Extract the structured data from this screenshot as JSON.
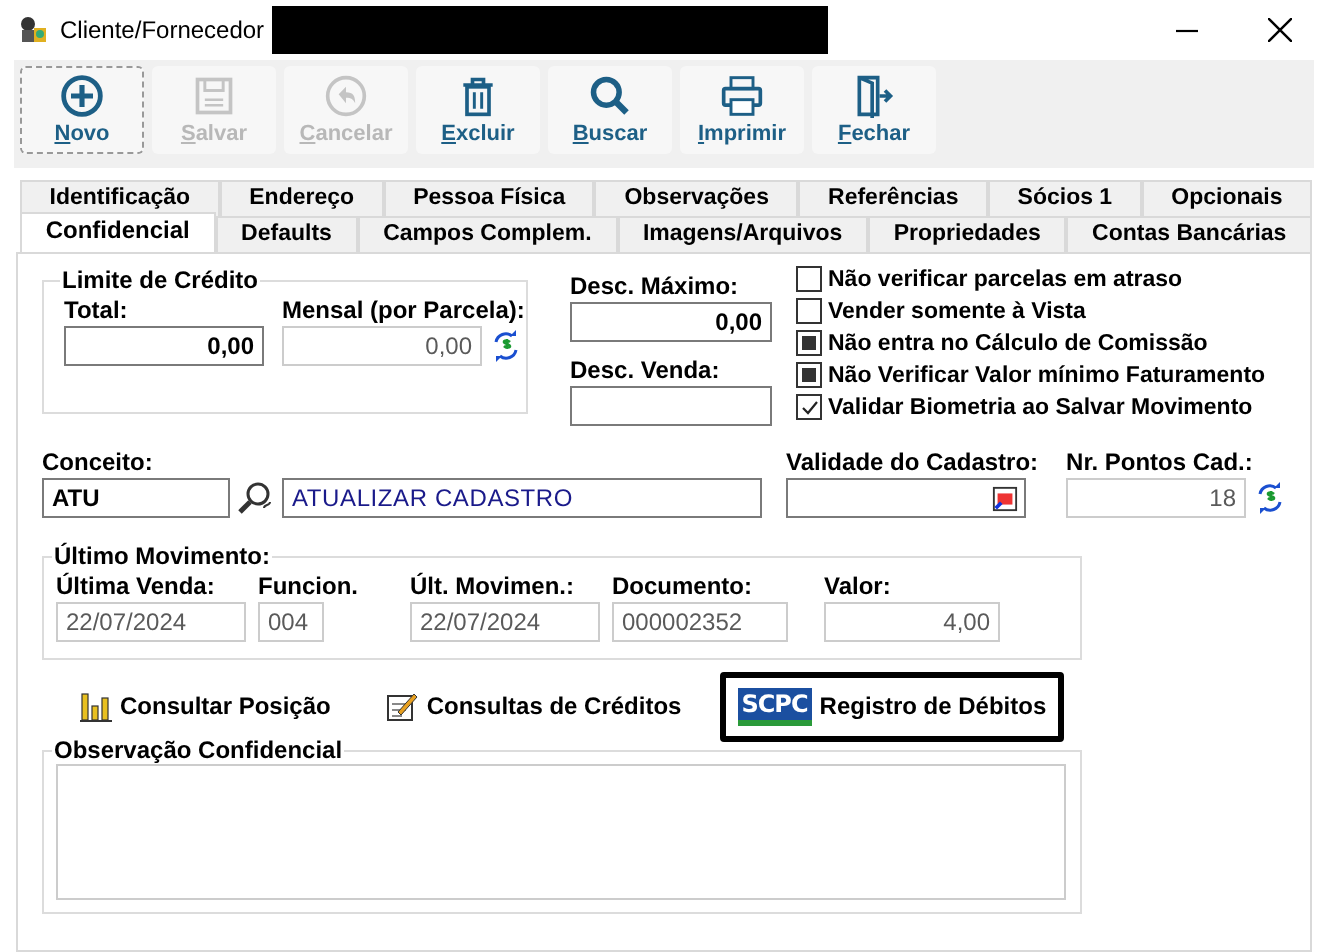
{
  "window": {
    "title": "Cliente/Fornecedor"
  },
  "toolbar": [
    {
      "label": "Novo",
      "kind": "plus",
      "disabled": false,
      "focused": true
    },
    {
      "label": "Salvar",
      "kind": "disk",
      "disabled": true,
      "focused": false
    },
    {
      "label": "Cancelar",
      "kind": "undo",
      "disabled": true,
      "focused": false
    },
    {
      "label": "Excluir",
      "kind": "trash",
      "disabled": false,
      "focused": false
    },
    {
      "label": "Buscar",
      "kind": "search",
      "disabled": false,
      "focused": false
    },
    {
      "label": "Imprimir",
      "kind": "printer",
      "disabled": false,
      "focused": false
    },
    {
      "label": "Fechar",
      "kind": "exit",
      "disabled": false,
      "focused": false
    }
  ],
  "tab_rows": [
    [
      {
        "label": "Identificação",
        "selected": false
      },
      {
        "label": "Endereço",
        "selected": false
      },
      {
        "label": "Pessoa Física",
        "selected": false
      },
      {
        "label": "Observações",
        "selected": false
      },
      {
        "label": "Referências",
        "selected": false
      },
      {
        "label": "Sócios 1",
        "selected": false
      },
      {
        "label": "Opcionais",
        "selected": false
      }
    ],
    [
      {
        "label": "Confidencial",
        "selected": true
      },
      {
        "label": "Defaults",
        "selected": false
      },
      {
        "label": "Campos Complem.",
        "selected": false
      },
      {
        "label": "Imagens/Arquivos",
        "selected": false
      },
      {
        "label": "Propriedades",
        "selected": false
      },
      {
        "label": "Contas Bancárias",
        "selected": false
      }
    ]
  ],
  "credit_limit": {
    "title": "Limite de Crédito",
    "total": {
      "label": "Total:",
      "value": "0,00",
      "disabled": false
    },
    "monthly": {
      "label": "Mensal (por Parcela):",
      "value": "0,00",
      "disabled": true
    }
  },
  "discounts": {
    "max": {
      "label": "Desc. Máximo:",
      "value": "0,00"
    },
    "sale": {
      "label": "Desc. Venda:"
    }
  },
  "options": [
    {
      "label": "Não verificar parcelas em atraso",
      "checked": false
    },
    {
      "label": "Vender somente à Vista",
      "checked": false
    },
    {
      "label": "Não entra no Cálculo de Comissão",
      "checked": true,
      "kind": "filled"
    },
    {
      "label": "Não Verificar Valor mínimo Faturamento",
      "checked": true,
      "kind": "filled"
    },
    {
      "label": "Validar Biometria ao Salvar Movimento",
      "checked": true,
      "kind": "tick"
    }
  ],
  "concept": {
    "label": "Conceito:",
    "code": "ATU",
    "description": "ATUALIZAR CADASTRO"
  },
  "validity": {
    "label": "Validade do Cadastro:"
  },
  "points": {
    "label": "Nr. Pontos Cad.:",
    "value": "18"
  },
  "last_movement": {
    "title": "Último Movimento:",
    "fields": [
      {
        "label": "Última Venda:",
        "value": "22/07/2024",
        "kind": "text"
      },
      {
        "label": "Funcion.",
        "value": "004",
        "kind": "text"
      },
      {
        "label": "Últ. Movimen.:",
        "value": "22/07/2024",
        "kind": "text"
      },
      {
        "label": "Documento:",
        "value": "000002352",
        "kind": "text"
      },
      {
        "label": "Valor:",
        "value": "4,00",
        "kind": "number"
      }
    ]
  },
  "actions": [
    {
      "label": "Consultar Posição",
      "kind": "chart",
      "highlighted": false
    },
    {
      "label": "Consultas de Créditos",
      "kind": "note",
      "highlighted": false
    },
    {
      "label": "Registro de Débitos",
      "kind": "logo",
      "logo_text": "SCPC",
      "highlighted": true
    }
  ],
  "notes": {
    "title": "Observação Confidencial"
  }
}
